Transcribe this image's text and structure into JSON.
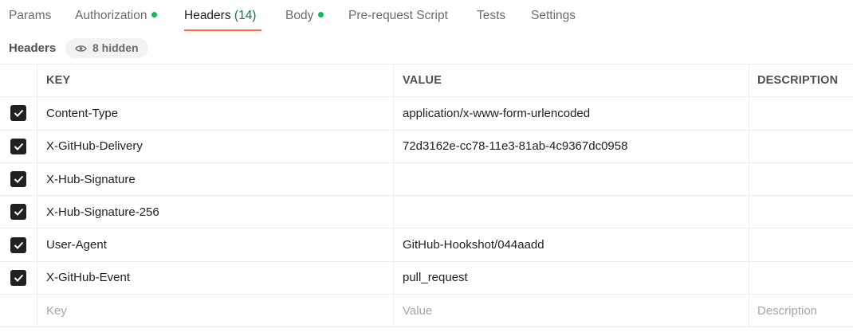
{
  "tabs": [
    {
      "label": "Params",
      "count": "",
      "dot": false,
      "active": false
    },
    {
      "label": "Authorization",
      "count": "",
      "dot": true,
      "active": false
    },
    {
      "label": "Headers",
      "count": "(14)",
      "dot": false,
      "active": true
    },
    {
      "label": "Body",
      "count": "",
      "dot": true,
      "active": false
    },
    {
      "label": "Pre-request Script",
      "count": "",
      "dot": false,
      "active": false
    },
    {
      "label": "Tests",
      "count": "",
      "dot": false,
      "active": false
    },
    {
      "label": "Settings",
      "count": "",
      "dot": false,
      "active": false
    }
  ],
  "section": {
    "title": "Headers",
    "hidden_label": "8 hidden",
    "hidden_icon": "eye-icon"
  },
  "table": {
    "columns": {
      "key": "KEY",
      "value": "VALUE",
      "description": "DESCRIPTION"
    },
    "rows": [
      {
        "checked": true,
        "key": "Content-Type",
        "value": "application/x-www-form-urlencoded",
        "description": ""
      },
      {
        "checked": true,
        "key": "X-GitHub-Delivery",
        "value": "72d3162e-cc78-11e3-81ab-4c9367dc0958",
        "description": ""
      },
      {
        "checked": true,
        "key": "X-Hub-Signature",
        "value": "",
        "description": ""
      },
      {
        "checked": true,
        "key": "X-Hub-Signature-256",
        "value": "",
        "description": ""
      },
      {
        "checked": true,
        "key": "User-Agent",
        "value": "GitHub-Hookshot/044aadd",
        "description": ""
      },
      {
        "checked": true,
        "key": "X-GitHub-Event",
        "value": "pull_request",
        "description": ""
      }
    ],
    "new_row": {
      "key_placeholder": "Key",
      "value_placeholder": "Value",
      "description_placeholder": "Description"
    }
  },
  "colors": {
    "accent": "#ff6c37",
    "status_dot": "#0cbb52",
    "count": "#0a7d48"
  }
}
